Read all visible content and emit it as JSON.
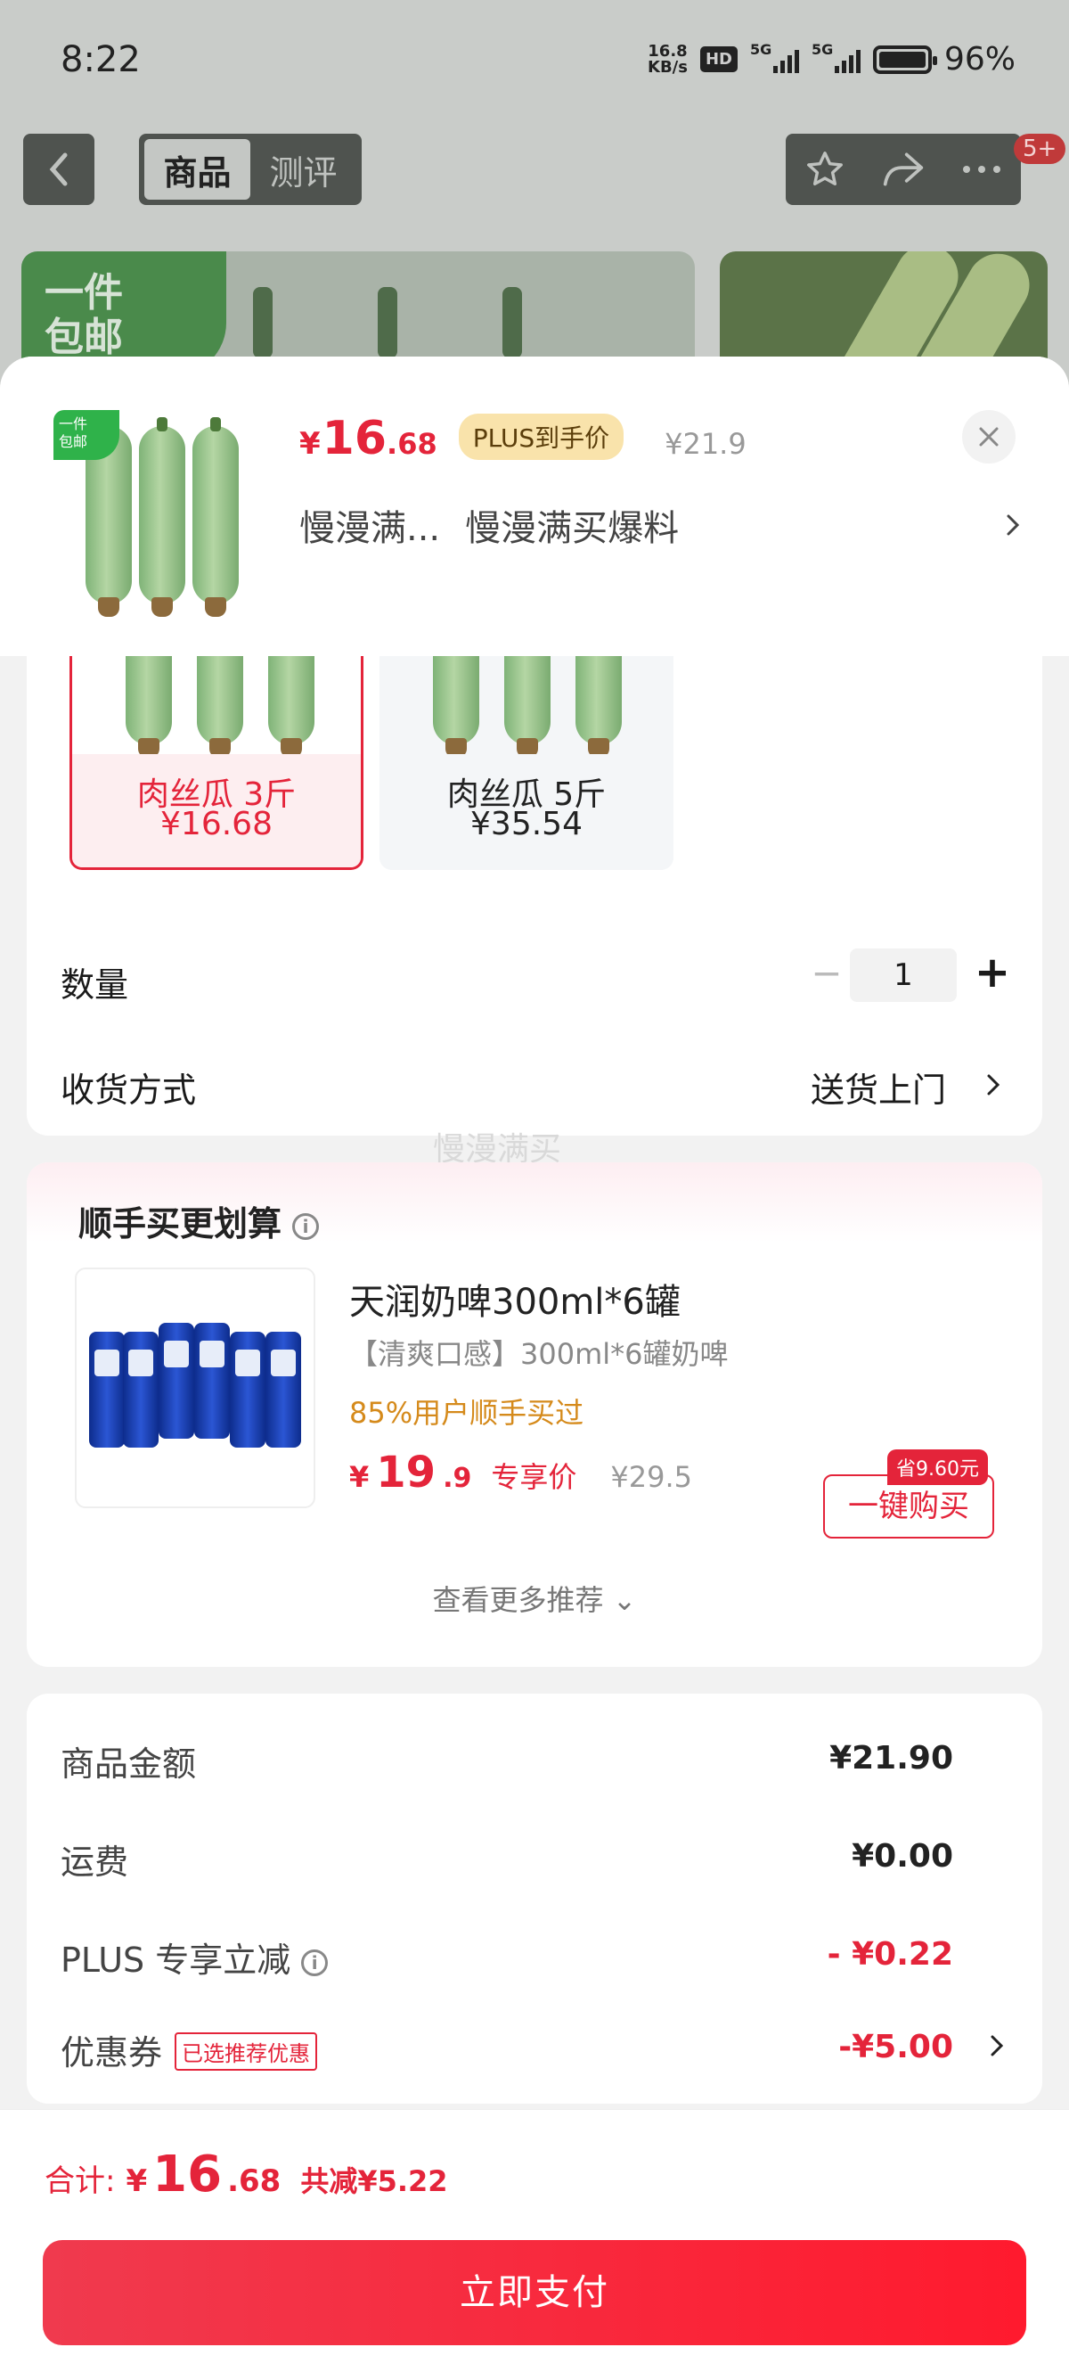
{
  "status_bar": {
    "time": "8:22",
    "net_speed_value": "16.8",
    "net_speed_unit": "KB/s",
    "hd": "HD",
    "sig1": "5G",
    "sig2": "5G",
    "battery_pct": "96%"
  },
  "nav": {
    "tabs": [
      "商品",
      "测评"
    ],
    "msg_badge": "5+"
  },
  "bg_banner_tag": "一件\n包邮",
  "product": {
    "free_tag": "一件\n包邮",
    "price_symbol": "¥",
    "price_int": "16",
    "price_dec": ".68",
    "plus_tag": "PLUS到手价",
    "orig_price": "¥21.9",
    "promo_1": "慢漫满...",
    "promo_2": "慢漫满买爆料"
  },
  "options": [
    {
      "name": "肉丝瓜 3斤",
      "price": "¥16.68"
    },
    {
      "name": "肉丝瓜 5斤",
      "price": "¥35.54"
    }
  ],
  "quantity": {
    "label": "数量",
    "minus": "−",
    "value": "1",
    "plus": "+"
  },
  "shipping": {
    "label": "收货方式",
    "value": "送货上门"
  },
  "watermark": "慢漫满买",
  "upsell": {
    "title": "顺手买更划算",
    "item_name": "天润奶啤300ml*6罐",
    "item_desc": "【清爽口感】300ml*6罐奶啤",
    "social_proof": "85%用户顺手买过",
    "price_symbol": "¥",
    "price_int": "19",
    "price_dec": ".9",
    "exclusive_label": "专享价",
    "orig_price": "¥29.5",
    "save_badge": "省9.60元",
    "buy_button": "一键购买",
    "more": "查看更多推荐 ⌄"
  },
  "summary": {
    "rows": [
      {
        "label": "商品金额",
        "value": "¥21.90"
      },
      {
        "label": "运费",
        "value": "¥0.00"
      },
      {
        "label": "PLUS 专享立减",
        "value": "- ¥0.22"
      },
      {
        "label": "优惠券",
        "value": "-¥5.00",
        "tag": "已选推荐优惠"
      }
    ]
  },
  "footer": {
    "total_label": "合计:",
    "total_symbol": "¥",
    "total_int": "16",
    "total_dec": ".68",
    "saved": "共减¥5.22",
    "pay_button": "立即支付"
  },
  "colors": {
    "accent_red": "#e4243a",
    "plus_gold": "#f9e3ab",
    "social_orange": "#d58a1b"
  }
}
